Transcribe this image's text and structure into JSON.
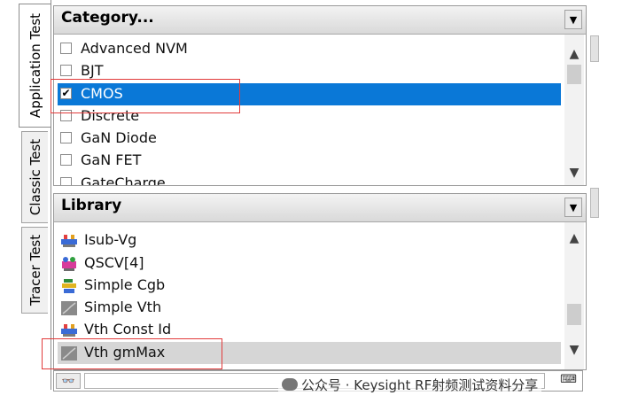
{
  "tabs": [
    {
      "label": "Application Test",
      "active": true
    },
    {
      "label": "Classic Test",
      "active": false
    },
    {
      "label": "Tracer Test",
      "active": false
    }
  ],
  "category": {
    "header": "Category...",
    "items": [
      {
        "label": "Advanced NVM",
        "checked": false
      },
      {
        "label": "BJT",
        "checked": false
      },
      {
        "label": "CMOS",
        "checked": true,
        "selected": true
      },
      {
        "label": "Discrete",
        "checked": false
      },
      {
        "label": "GaN Diode",
        "checked": false
      },
      {
        "label": "GaN FET",
        "checked": false
      },
      {
        "label": "GateCharge",
        "checked": false
      }
    ]
  },
  "library": {
    "header": "Library",
    "items": [
      {
        "label": "Isub-Vg",
        "icon": "multi-device-icon"
      },
      {
        "label": "QSCV[4]",
        "icon": "cv-probe-icon"
      },
      {
        "label": "Simple Cgb",
        "icon": "capacitor-icon"
      },
      {
        "label": "Simple Vth",
        "icon": "graph-icon"
      },
      {
        "label": "Vth Const Id",
        "icon": "multi-device-icon"
      },
      {
        "label": "Vth gmMax",
        "icon": "graph-icon"
      }
    ]
  },
  "search": {
    "find_icon": "binoculars-icon",
    "keyboard_icon": "keyboard-icon"
  },
  "watermark": {
    "text": "公众号 · Keysight RF射频测试资料分享"
  },
  "colors": {
    "selection": "#0a78d7",
    "highlight_box": "#e23b3b"
  }
}
